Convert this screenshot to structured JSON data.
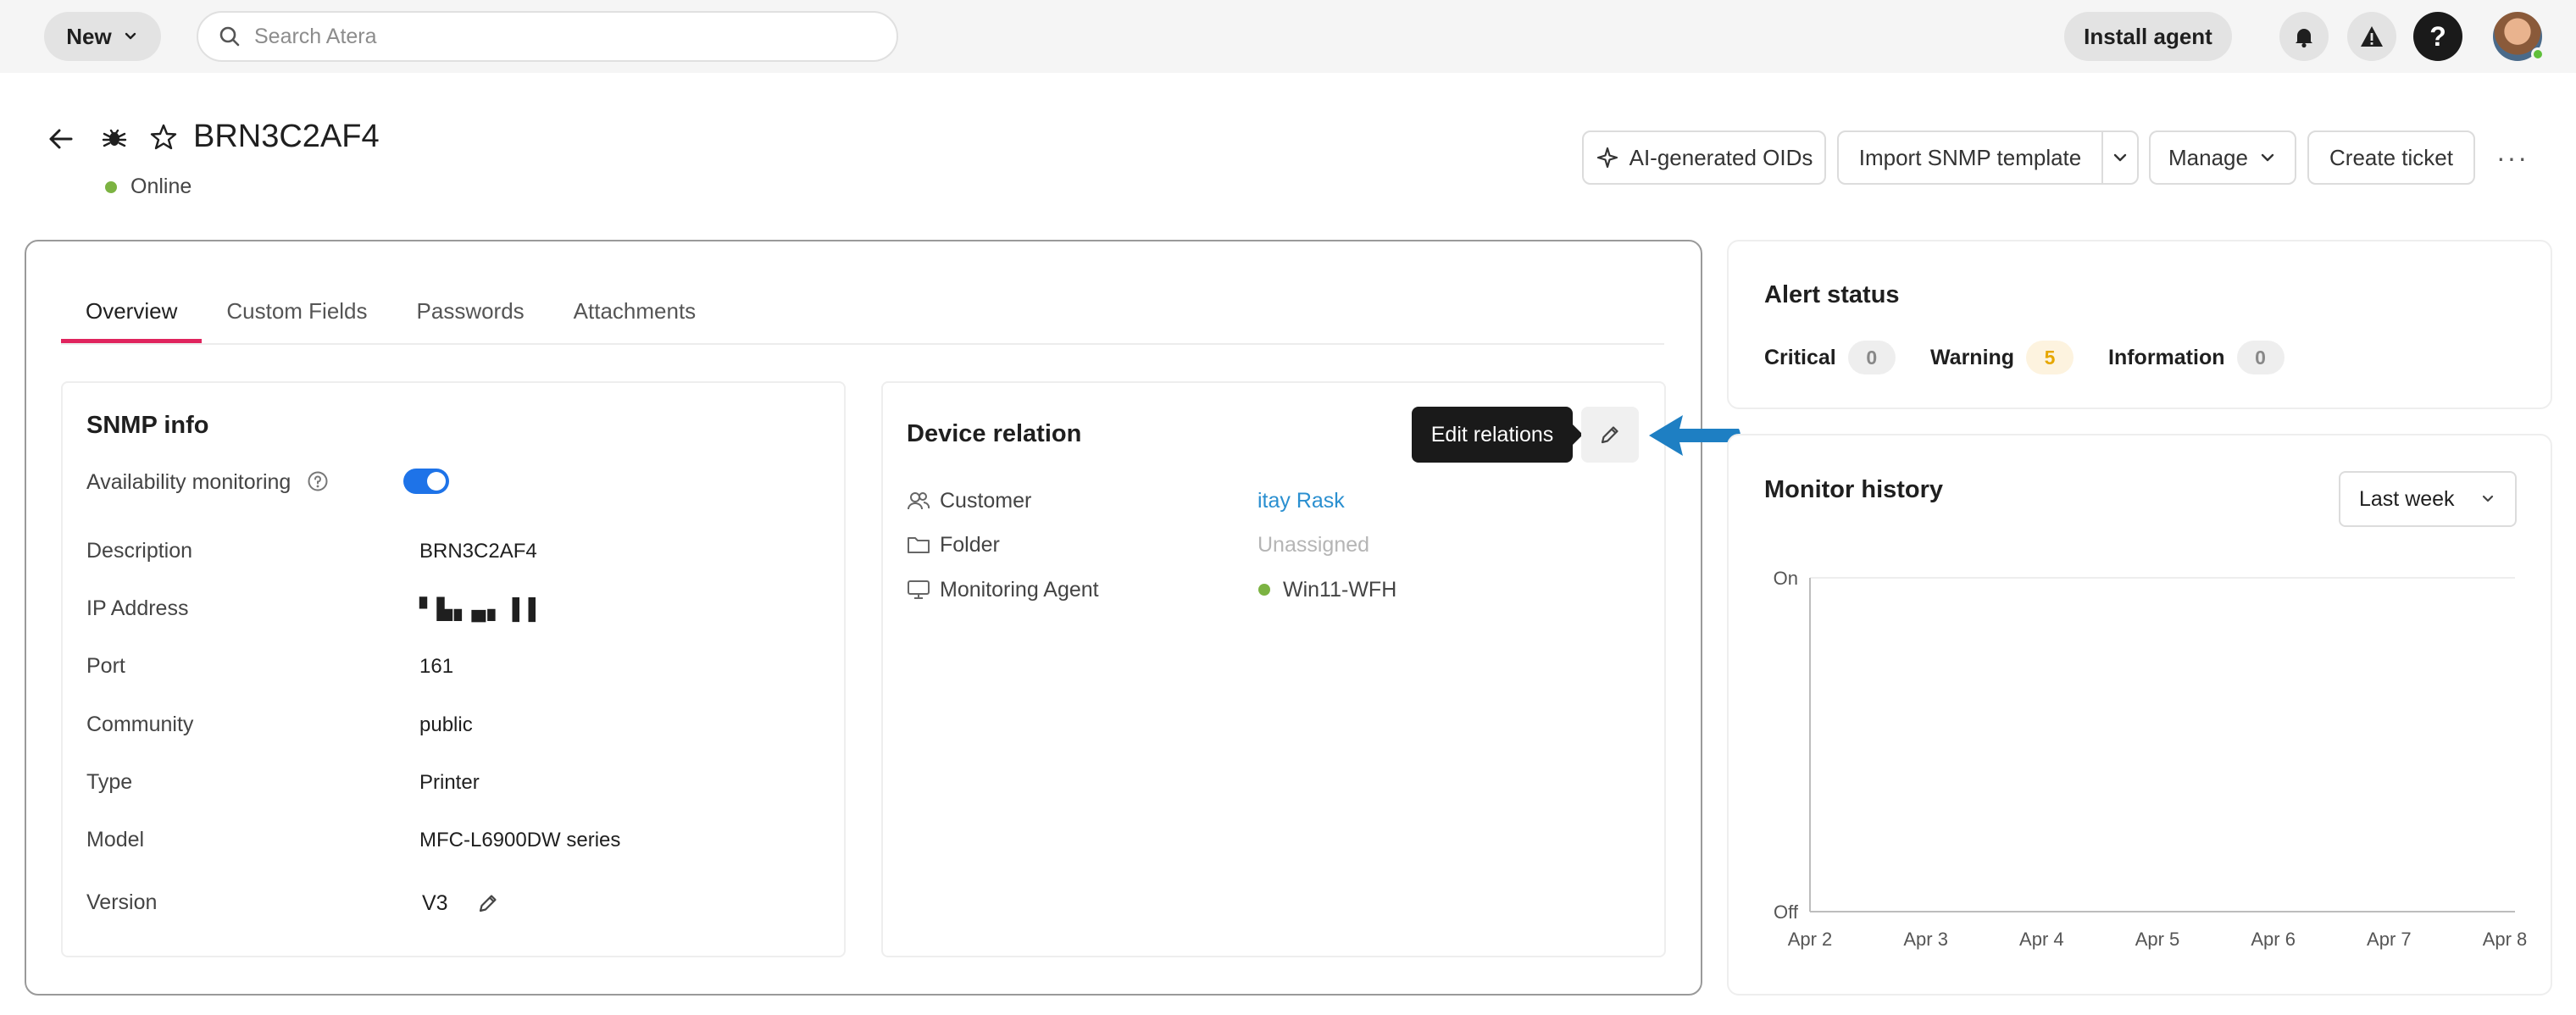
{
  "topbar": {
    "new_label": "New",
    "search_placeholder": "Search Atera",
    "install_label": "Install agent",
    "help_label": "?"
  },
  "header": {
    "device_name": "BRN3C2AF4",
    "status": "Online",
    "status_color": "#7cb342",
    "buttons": {
      "ai_oids": "AI-generated OIDs",
      "import_snmp": "Import SNMP template",
      "manage": "Manage",
      "create_ticket": "Create ticket"
    },
    "more": "···"
  },
  "tabs": [
    "Overview",
    "Custom Fields",
    "Passwords",
    "Attachments"
  ],
  "snmp_info": {
    "title": "SNMP info",
    "availability_label": "Availability monitoring",
    "availability_enabled": true,
    "rows": [
      {
        "label": "Description",
        "value": "BRN3C2AF4"
      },
      {
        "label": "IP Address",
        "value": "▘▙▖▄▖ ▌▌"
      },
      {
        "label": "Port",
        "value": "161"
      },
      {
        "label": "Community",
        "value": "public"
      },
      {
        "label": "Type",
        "value": "Printer"
      },
      {
        "label": "Model",
        "value": "MFC-L6900DW series"
      },
      {
        "label": "Version",
        "value": "V3"
      }
    ]
  },
  "device_relation": {
    "title": "Device relation",
    "tooltip": "Edit relations",
    "rows": [
      {
        "label": "Customer",
        "value": "itay Rask",
        "icon": "users-icon"
      },
      {
        "label": "Folder",
        "value": "Unassigned",
        "icon": "folder-icon"
      },
      {
        "label": "Monitoring Agent",
        "value": "Win11-WFH",
        "icon": "monitor-icon"
      }
    ]
  },
  "alert_status": {
    "title": "Alert status",
    "items": [
      {
        "label": "Critical",
        "count": "0"
      },
      {
        "label": "Warning",
        "count": "5"
      },
      {
        "label": "Information",
        "count": "0"
      }
    ],
    "warning_color": "#e6a700"
  },
  "monitor_history": {
    "title": "Monitor history",
    "range": "Last week"
  },
  "chart_data": {
    "type": "line",
    "title": "Monitor history",
    "categories": [
      "Apr 2",
      "Apr 3",
      "Apr 4",
      "Apr 5",
      "Apr 6",
      "Apr 7",
      "Apr 8"
    ],
    "y_ticks": [
      "On",
      "Off"
    ],
    "series": [],
    "grid": false
  }
}
